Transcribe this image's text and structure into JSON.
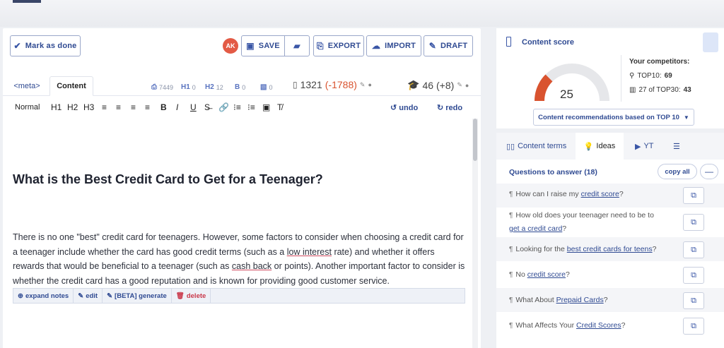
{
  "toolbar": {
    "mark_done": "Mark as done",
    "avatar": "AK",
    "save": "SAVE",
    "export": "EXPORT",
    "import": "IMPORT",
    "draft": "DRAFT"
  },
  "tabs": {
    "meta": "<meta>",
    "content": "Content"
  },
  "stats": {
    "images": "7449",
    "h1": "0",
    "h2": "12",
    "b": "0",
    "media": "0",
    "words": "1321",
    "words_diff": "(-1788)",
    "headings": "46",
    "headings_diff": "(+8)"
  },
  "format": {
    "normal": "Normal",
    "h1": "H1",
    "h2": "H2",
    "h3": "H3",
    "undo": "undo",
    "redo": "redo"
  },
  "document": {
    "heading": "What is the Best Credit Card to Get for a Teenager?",
    "p_a": "There is no one \"best\" credit card for teenagers. However, some factors to consider when choosing a credit card for a teenager include whether the card has good credit terms (such as a ",
    "p_k1": "low interest",
    "p_b": " rate) and whether it offers rewards that would be beneficial to a teenager (such as ",
    "p_k2": "cash back",
    "p_c": " or points). Another important factor to consider is whether the credit card has a good reputation and is known for providing good customer service."
  },
  "notes": {
    "expand": "expand notes",
    "edit": "edit",
    "generate": "[BETA] generate",
    "delete": "delete"
  },
  "score": {
    "title": "Content score",
    "value": "25",
    "competitors": "Your competitors:",
    "top10_label": "TOP10:",
    "top10_value": "69",
    "top30_label": "27 of TOP30:",
    "top30_value": "43",
    "reco": "Content recommendations based on TOP 10",
    "gauge_fraction": 0.25
  },
  "ideas": {
    "tab_terms": "Content terms",
    "tab_ideas": "Ideas",
    "tab_yt": "YT",
    "heading": "Questions to answer (18)",
    "copy_all": "copy all",
    "q1_a": "How can I raise my ",
    "q1_k": "credit score",
    "q1_b": "?",
    "q2_a": "How old does your teenager need to be to ",
    "q2_k": "get a credit card",
    "q2_b": "?",
    "q3_a": "Looking for the ",
    "q3_k": "best credit cards for teens",
    "q3_b": "?",
    "q4_a": "No ",
    "q4_k": "credit score",
    "q4_b": "?",
    "q5_a": "What About ",
    "q5_k": "Prepaid Cards",
    "q5_b": "?",
    "q6_a": "What Affects Your ",
    "q6_k": "Credit Scores",
    "q6_b": "?"
  },
  "colors": {
    "accent": "#2f4a92",
    "gauge_low": "#d9532f",
    "gauge_mid": "#f0a030",
    "gauge_bg": "#e6e7ea"
  }
}
